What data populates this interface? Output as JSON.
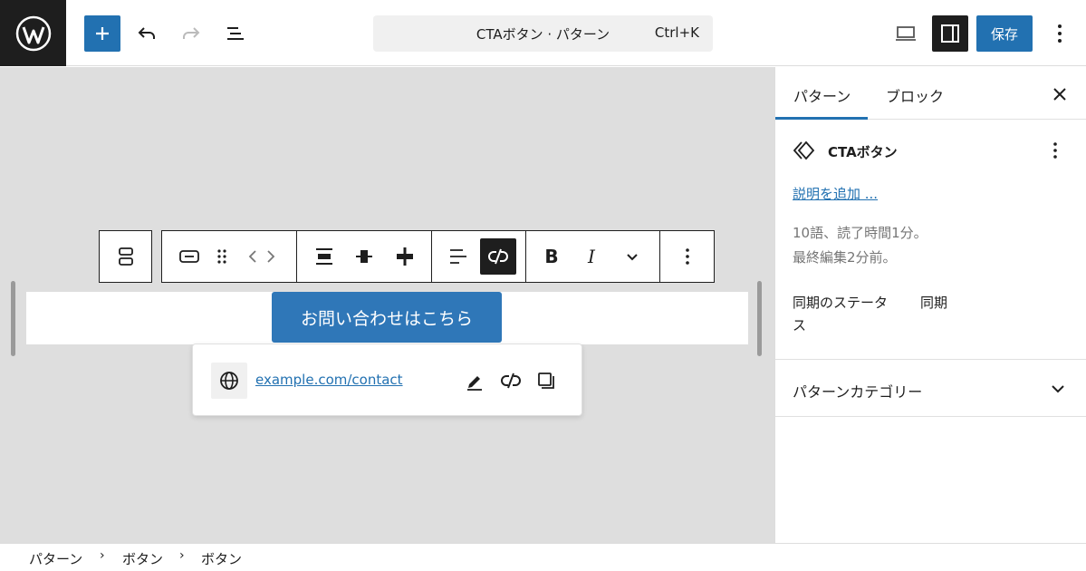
{
  "topbar": {
    "document_title": "CTAボタン · パターン",
    "shortcut": "Ctrl+K",
    "save_label": "保存"
  },
  "canvas": {
    "button_text": "お問い合わせはこちら",
    "link_url": "example.com/contact"
  },
  "block_toolbar": {
    "bold": "B",
    "italic": "I"
  },
  "sidebar": {
    "tabs": [
      {
        "label": "パターン",
        "active": true
      },
      {
        "label": "ブロック",
        "active": false
      }
    ],
    "pattern_name": "CTAボタン",
    "add_description": "説明を追加 ...",
    "meta_line1": "10語、読了時間1分。",
    "meta_line2": "最終編集2分前。",
    "sync_label_line1": "同期のステータ",
    "sync_label_line2": "ス",
    "sync_value": "同期",
    "category_panel": "パターンカテゴリー"
  },
  "breadcrumb": {
    "items": [
      "パターン",
      "ボタン",
      "ボタン"
    ],
    "separator": "›"
  },
  "colors": {
    "accent": "#2271b1",
    "cta_button": "#2f77b8",
    "dark": "#1e1e1e",
    "canvas_bg": "#dedede"
  }
}
